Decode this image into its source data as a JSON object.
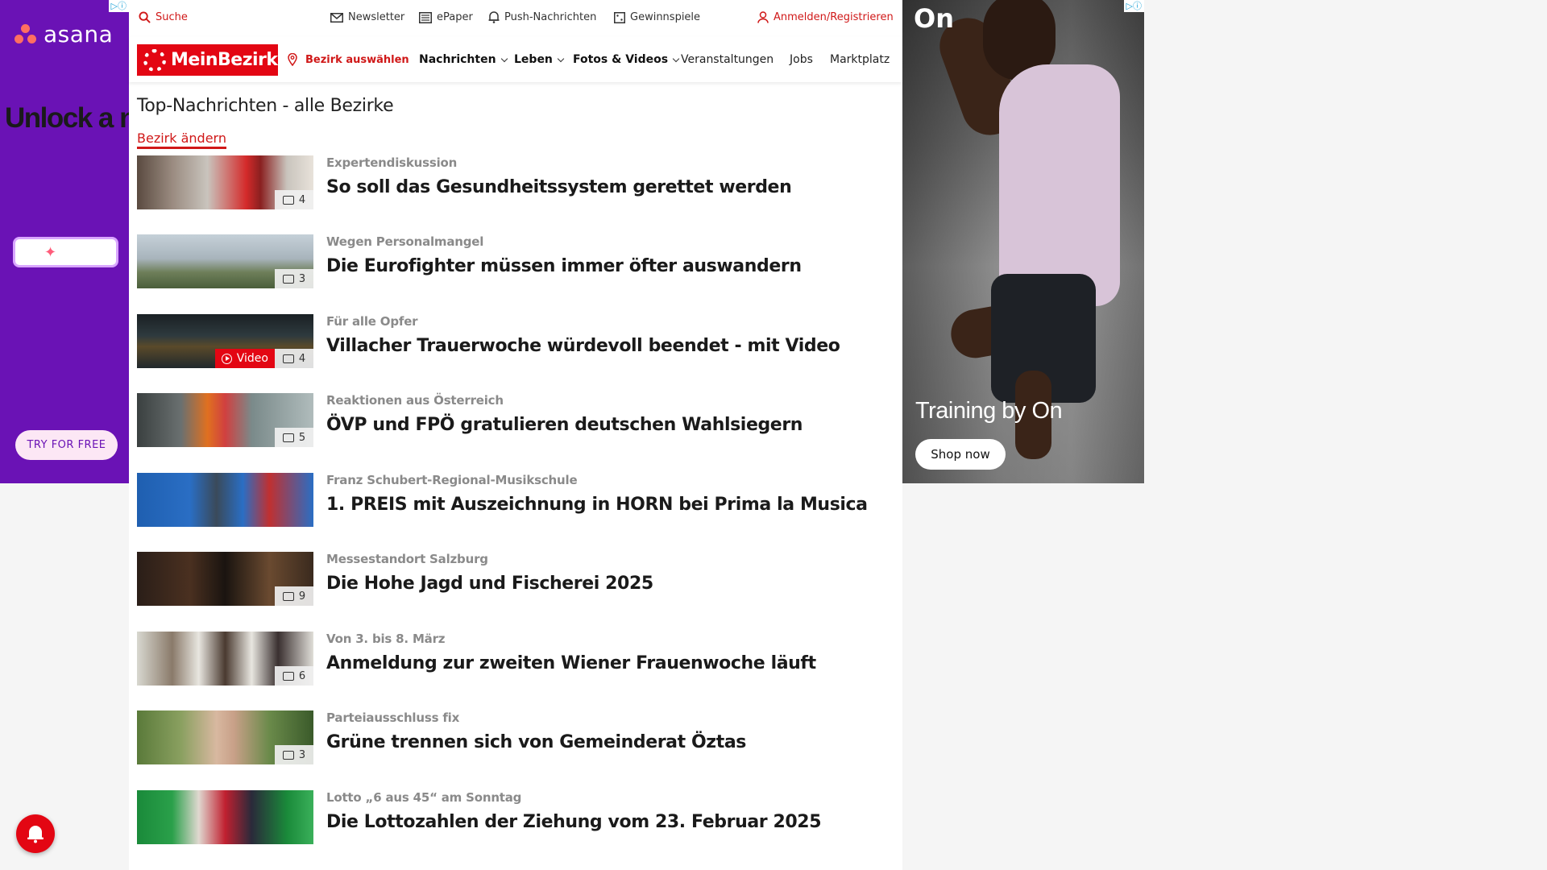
{
  "left_ad": {
    "adchoice": "▷ⓘ",
    "brand": "asana",
    "headline": "Unlock a new world of efficiency",
    "cta": "TRY FOR FREE",
    "colors": {
      "background": "#6a12b5",
      "accent": "#ff6f61"
    }
  },
  "right_ad": {
    "adchoice": "▷ⓘ",
    "logo": "On",
    "tagline": "Training by On",
    "cta": "Shop now"
  },
  "topbar": {
    "search": "Suche",
    "newsletter": "Newsletter",
    "epaper": "ePaper",
    "push": "Push-Nachrichten",
    "games": "Gewinnspiele",
    "login": "Anmelden/Registrieren"
  },
  "nav": {
    "logo": "MeinBezirk",
    "district": "Bezirk auswählen",
    "items": [
      {
        "label": "Nachrichten",
        "dropdown": true
      },
      {
        "label": "Leben",
        "dropdown": true
      },
      {
        "label": "Fotos & Videos",
        "dropdown": true
      },
      {
        "label": "Veranstaltungen",
        "dropdown": false
      },
      {
        "label": "Jobs",
        "dropdown": false
      },
      {
        "label": "Marktplatz",
        "dropdown": false
      }
    ]
  },
  "page": {
    "title": "Top-Nachrichten - alle Bezirke",
    "change_district": "Bezirk ändern"
  },
  "articles": [
    {
      "kicker": "Expertendiskussion",
      "headline": "So soll das Gesundheitssystem gerettet werden",
      "images": "4",
      "video": ""
    },
    {
      "kicker": "Wegen Personalmangel",
      "headline": "Die Eurofighter müssen immer öfter auswandern",
      "images": "3",
      "video": ""
    },
    {
      "kicker": "Für alle Opfer",
      "headline": "Villacher Trauerwoche würdevoll beendet - mit Video",
      "images": "4",
      "video": "Video"
    },
    {
      "kicker": "Reaktionen aus Österreich",
      "headline": "ÖVP und FPÖ gratulieren deutschen Wahlsiegern",
      "images": "5",
      "video": ""
    },
    {
      "kicker": "Franz Schubert-Regional-Musikschule",
      "headline": "1. PREIS mit Auszeichnung in HORN bei Prima la Musica",
      "images": "",
      "video": ""
    },
    {
      "kicker": "Messestandort Salzburg",
      "headline": "Die Hohe Jagd und Fischerei 2025",
      "images": "9",
      "video": ""
    },
    {
      "kicker": "Von 3. bis 8. März",
      "headline": "Anmeldung zur zweiten Wiener Frauenwoche läuft",
      "images": "6",
      "video": ""
    },
    {
      "kicker": "Parteiausschluss fix",
      "headline": "Grüne trennen sich von Gemeinderat Öztas",
      "images": "3",
      "video": ""
    },
    {
      "kicker": "Lotto „6 aus 45“ am Sonntag",
      "headline": "Die Lottozahlen der Ziehung vom 23. Februar 2025",
      "images": "",
      "video": ""
    }
  ],
  "colors": {
    "brand_red": "#e30613",
    "text": "#1a1a1a",
    "kicker": "#8a8a8a"
  }
}
